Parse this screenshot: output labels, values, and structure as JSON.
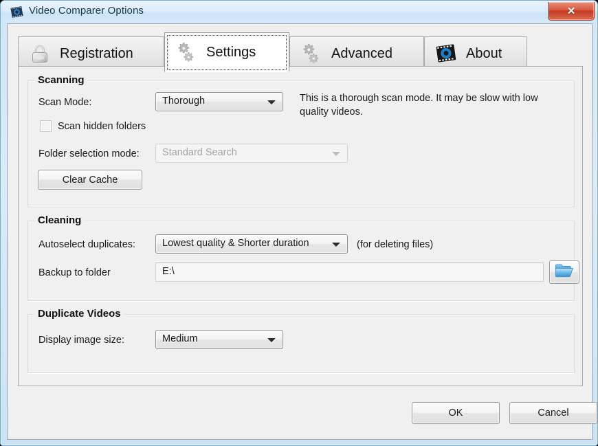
{
  "window": {
    "title": "Video Comparer Options",
    "icon": "video-film-icon",
    "close_label": "✕"
  },
  "tabs": [
    {
      "label": "Registration",
      "icon": "padlock-icon",
      "active": false
    },
    {
      "label": "Settings",
      "icon": "gears-icon",
      "active": true
    },
    {
      "label": "Advanced",
      "icon": "gears-icon",
      "active": false
    },
    {
      "label": "About",
      "icon": "film-reel-icon",
      "active": false
    }
  ],
  "scanning": {
    "group_title": "Scanning",
    "scan_mode_label": "Scan Mode:",
    "scan_mode_value": "Thorough",
    "scan_mode_description": "This is a thorough scan mode. It may be slow with low quality videos.",
    "scan_hidden_label": "Scan hidden folders",
    "scan_hidden_checked": false,
    "folder_selection_label": "Folder selection mode:",
    "folder_selection_value": "Standard Search",
    "folder_selection_enabled": false,
    "clear_cache_label": "Clear Cache"
  },
  "cleaning": {
    "group_title": "Cleaning",
    "autoselect_label": "Autoselect duplicates:",
    "autoselect_value": "Lowest quality & Shorter duration",
    "autoselect_hint": "(for deleting files)",
    "backup_label": "Backup to folder",
    "backup_value": "E:\\",
    "browse_icon": "folder-open-icon"
  },
  "duplicate_videos": {
    "group_title": "Duplicate Videos",
    "display_size_label": "Display image size:",
    "display_size_value": "Medium"
  },
  "footer": {
    "ok_label": "OK",
    "cancel_label": "Cancel"
  },
  "colors": {
    "accent_blue": "#3b86c8",
    "close_red": "#c23a22",
    "folder_blue": "#4da3e0",
    "window_bg": "#f0f0f0"
  }
}
